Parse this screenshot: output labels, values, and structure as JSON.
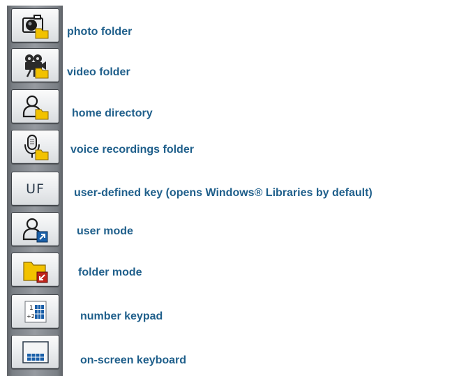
{
  "keys": [
    {
      "id": "photo",
      "label": "photo folder",
      "icon": "photo-folder-icon"
    },
    {
      "id": "video",
      "label": "video folder",
      "icon": "video-folder-icon"
    },
    {
      "id": "home",
      "label": "home directory",
      "icon": "home-directory-icon"
    },
    {
      "id": "voice",
      "label": "voice recordings folder",
      "icon": "voice-recordings-folder-icon"
    },
    {
      "id": "uf",
      "label": "user-defined key (opens Windows® Libraries by default)",
      "icon": "user-defined-key-icon",
      "key_text": "UF"
    },
    {
      "id": "user-mode",
      "label": "user mode",
      "icon": "user-mode-icon"
    },
    {
      "id": "folder-mode",
      "label": "folder mode",
      "icon": "folder-mode-icon"
    },
    {
      "id": "keypad",
      "label": "number keypad",
      "icon": "number-keypad-icon",
      "key_digits": [
        "1",
        "+2"
      ]
    },
    {
      "id": "keyboard",
      "label": "on-screen keyboard",
      "icon": "on-screen-keyboard-icon"
    }
  ],
  "colors": {
    "label_text": "#1f5f8b",
    "folder_yellow": "#f2c200",
    "arrow_blue": "#1a5fa8",
    "arrow_red": "#c0241c"
  }
}
